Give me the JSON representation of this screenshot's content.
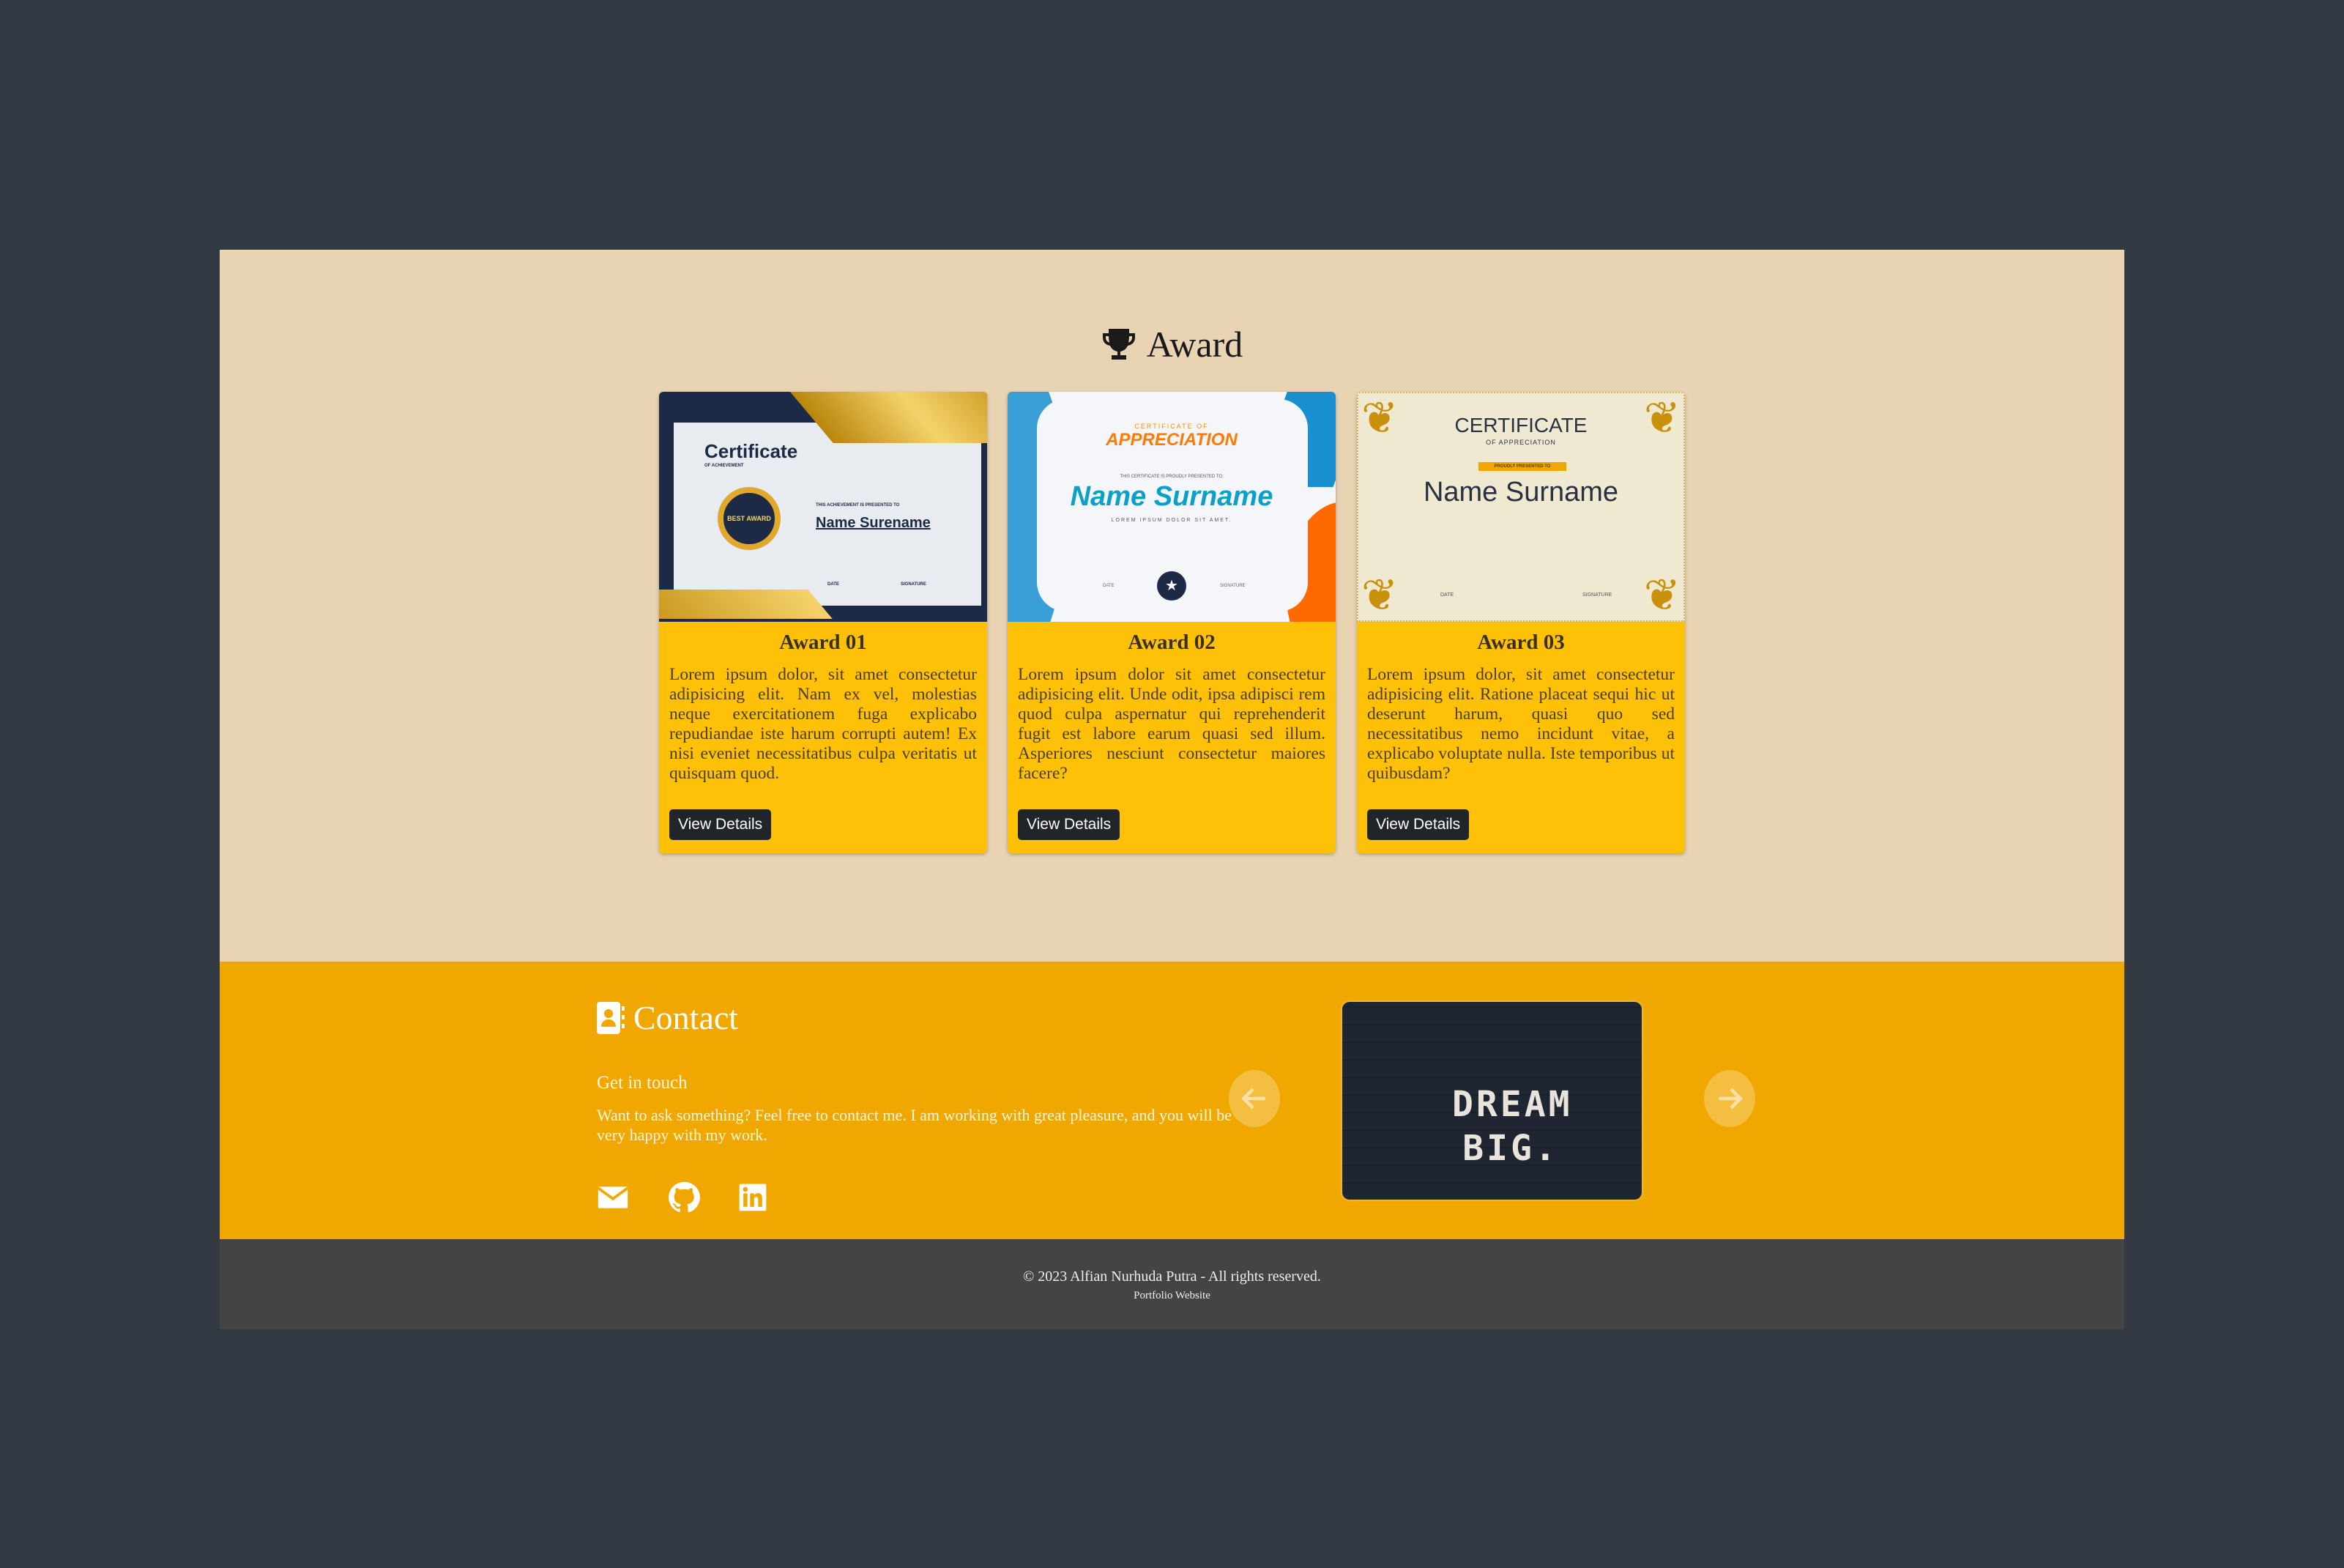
{
  "award": {
    "title": "Award",
    "icon": "trophy-icon",
    "cards": [
      {
        "title": "Award 01",
        "body": "Lorem ipsum dolor, sit amet consectetur adipisicing elit. Nam ex vel, molestias neque exercitationem fuga explicabo repudiandae iste harum corrupti autem! Ex nisi eveniet necessitatibus culpa veritatis ut quisquam quod.",
        "button": "View Details",
        "image": {
          "heading": "Certificate",
          "sub": "OF ACHIEVEMENT",
          "badge": "BEST AWARD",
          "presented": "THIS ACHIEVEMENT IS PRESENTED TO",
          "name": "Name Surename",
          "date": "DATE",
          "signature": "SIGNATURE"
        }
      },
      {
        "title": "Award 02",
        "body": "Lorem ipsum dolor sit amet consectetur adipisicing elit. Unde odit, ipsa adipisci rem quod culpa aspernatur qui reprehenderit fugit est labore earum quasi sed illum. Asperiores nesciunt consectetur maiores facere?",
        "button": "View Details",
        "image": {
          "top": "CERTIFICATE OF",
          "heading": "APPRECIATION",
          "presented": "THIS CERTIFICATE IS PROUDLY PRESENTED TO:",
          "name": "Name Surname",
          "sub": "LOREM IPSUM DOLOR SIT AMET.",
          "date": "DATE",
          "signature": "SIGNATURE"
        }
      },
      {
        "title": "Award 03",
        "body": "Lorem ipsum dolor, sit amet consectetur adipisicing elit. Ratione placeat sequi hic ut deserunt harum, quasi quo sed necessitatibus nemo incidunt vitae, a explicabo voluptate nulla. Iste temporibus ut quibusdam?",
        "button": "View Details",
        "image": {
          "heading": "CERTIFICATE",
          "sub": "OF APPRECIATION",
          "ribbon": "PROUDLY PRESENTED TO",
          "name": "Name Surname",
          "date": "DATE",
          "signature": "SIGNATURE"
        }
      }
    ]
  },
  "contact": {
    "title": "Contact",
    "subtitle": "Get in touch",
    "text": "Want to ask something? Feel free to contact me. I am working with great pleasure, and you will be very happy with my work.",
    "social": [
      "envelope-icon",
      "github-icon",
      "linkedin-icon"
    ],
    "carousel": {
      "image_text": "DREAM BIG."
    }
  },
  "footer": {
    "copyright": "© 2023 Alfian Nurhuda Putra - All rights reserved.",
    "sub": "Portfolio Website"
  },
  "colors": {
    "background": "#333a44",
    "award_bg": "#e8d3b3",
    "card": "#ffc107",
    "contact_bg": "#f0a800",
    "footer_bg": "#444444",
    "button": "#212529"
  }
}
